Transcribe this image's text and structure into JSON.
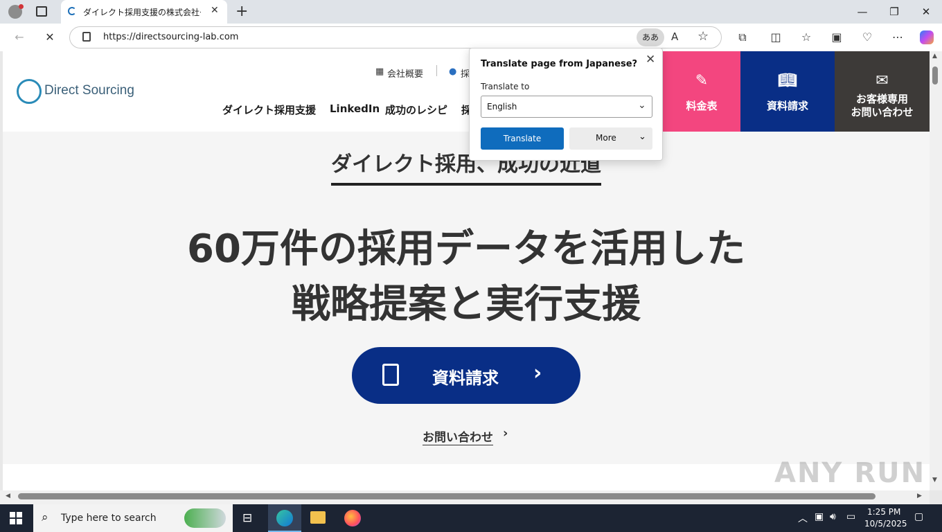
{
  "browser": {
    "tab_title": "ダイレクト採用支援の株式会社ダイレ",
    "url": "https://directsourcing-lab.com",
    "translate_chip": "ああ",
    "accent": "#0f6cbd"
  },
  "site": {
    "logo_text": "Direct Sourcing",
    "util_links": [
      "会社概要",
      "採"
    ],
    "nav": [
      "ダイレクト採用支援",
      "LinkedIn",
      "成功のレシピ",
      "採"
    ],
    "cta_buttons": [
      {
        "label": "料金表",
        "color": "#f3467f",
        "icon": "document-edit-icon"
      },
      {
        "label": "資料請求",
        "color": "#092e86",
        "icon": "book-open-icon"
      },
      {
        "label_line1": "お客様専用",
        "label_line2": "お問い合わせ",
        "color": "#3d3a38",
        "icon": "envelope-icon"
      }
    ],
    "section_title": "ダイレクト採用、成功の近道",
    "hero_line1": "60万件の採用データを活用した",
    "hero_line2": "戦略提案と実行支援",
    "main_cta": "資料請求",
    "contact_link": "お問い合わせ"
  },
  "translate_popup": {
    "title": "Translate page from Japanese?",
    "subtitle": "Translate to",
    "language": "English",
    "translate_button": "Translate",
    "more_button": "More"
  },
  "taskbar": {
    "search_placeholder": "Type here to search",
    "time": "1:25 PM",
    "date": "10/5/2025"
  },
  "watermark": "ANY RUN"
}
